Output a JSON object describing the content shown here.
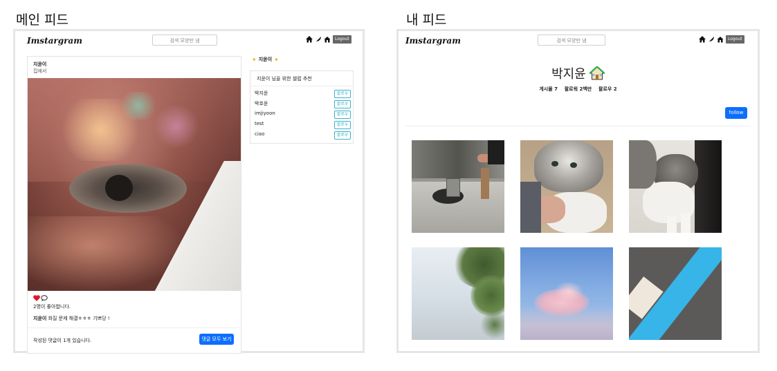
{
  "captions": {
    "left": "메인 피드",
    "right": "내 피드"
  },
  "brand": "Imstargram",
  "search_placeholder": "검색 모양만 냄",
  "logout_label": "Logout",
  "nav_icons": [
    "home-icon",
    "feather-icon",
    "house-icon"
  ],
  "feed": {
    "post": {
      "author": "지윤이",
      "location": "집에서",
      "likes_text": "2명이 좋아합니다.",
      "caption_author": "지윤이",
      "caption_text": "화질 문제 해결ㅎㅎㅎ 기쁘당 !",
      "comment_count_text": "작성된 댓글이 1개 있습니다.",
      "view_all_label": "댓글 모두 보기"
    },
    "side": {
      "user": "지윤이",
      "recommend_title": "지윤이 님을 위한 셀럽 추천",
      "follow_label": "팔로우",
      "recommendations": [
        "박지윤",
        "박호윤",
        "imjiyoon",
        "test",
        "ciao"
      ]
    }
  },
  "profile": {
    "name": "박지윤",
    "stats": [
      {
        "label": "게시물",
        "value": "7"
      },
      {
        "label": "팔로워",
        "value": "2백만"
      },
      {
        "label": "팔로우",
        "value": "2"
      }
    ],
    "follow_button": "follow",
    "photos": [
      "coffee-machine",
      "cat-held",
      "cat-standing",
      "tree-sky",
      "pink-cloud",
      "blue-tape"
    ]
  },
  "colors": {
    "primary": "#0d6efd",
    "follow_outline": "#3ab0c9",
    "logout": "#666666",
    "heart": "#e0192b"
  }
}
